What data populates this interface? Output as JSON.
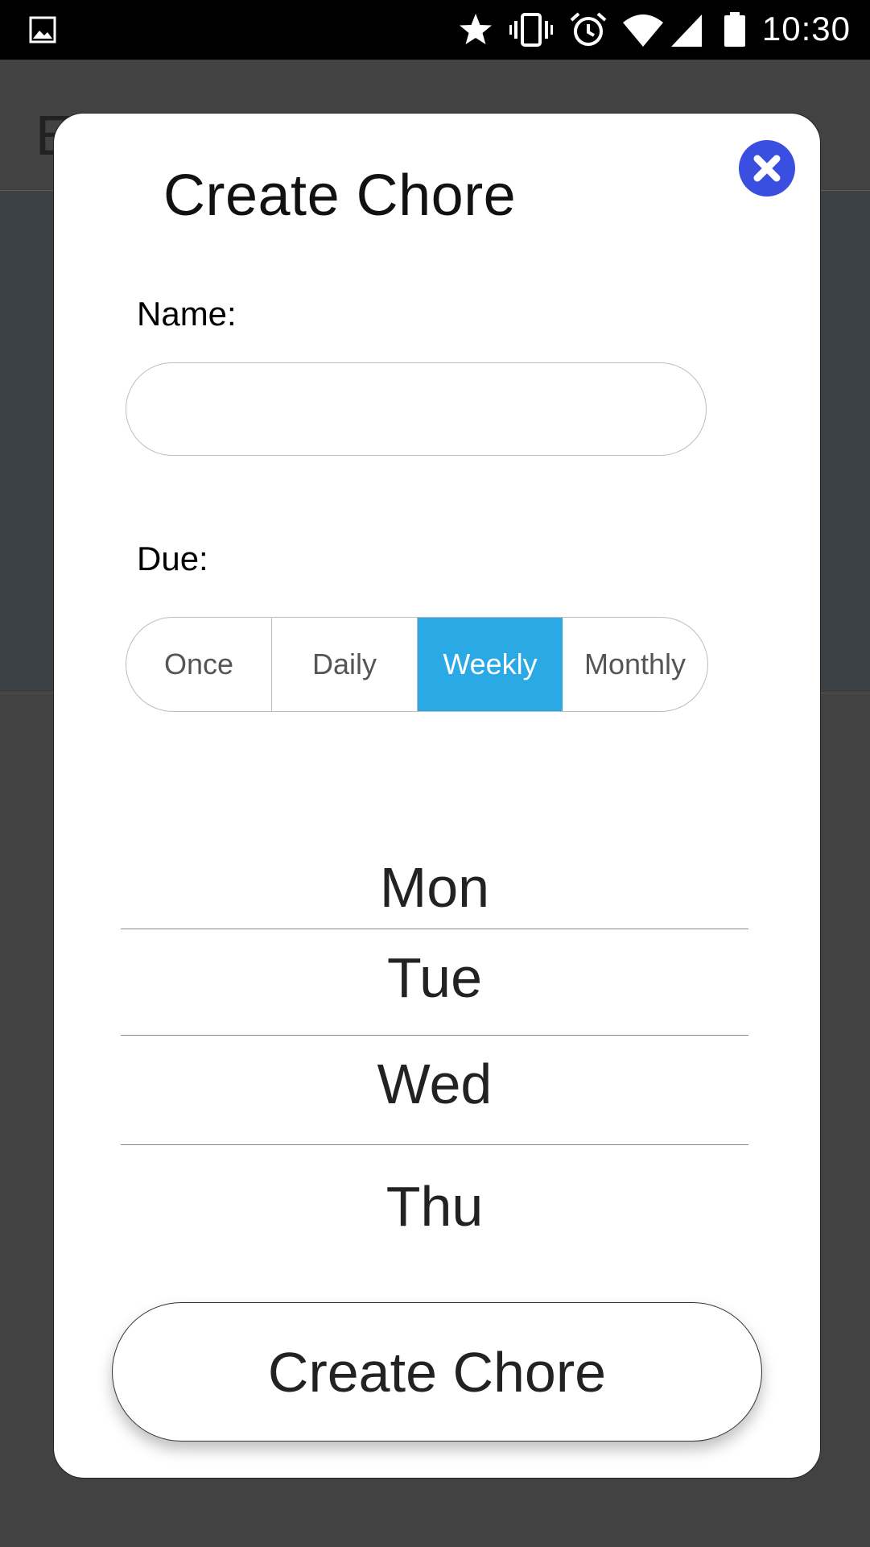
{
  "status_bar": {
    "time": "10:30",
    "icons": [
      "image-icon",
      "star-icon",
      "vibrate-icon",
      "alarm-icon",
      "wifi-icon",
      "signal-icon",
      "battery-icon"
    ]
  },
  "background": {
    "partial_letter": "E"
  },
  "modal": {
    "title": "Create Chore",
    "name_label": "Name:",
    "name_value": "",
    "due_label": "Due:",
    "due_options": [
      "Once",
      "Daily",
      "Weekly",
      "Monthly"
    ],
    "due_selected": "Weekly",
    "day_picker": [
      "Mon",
      "Tue",
      "Wed",
      "Thu"
    ],
    "submit_label": "Create Chore"
  },
  "colors": {
    "accent_selected": "#2aa9e4",
    "close_button": "#3a4fe0",
    "overlay": "#424242"
  }
}
